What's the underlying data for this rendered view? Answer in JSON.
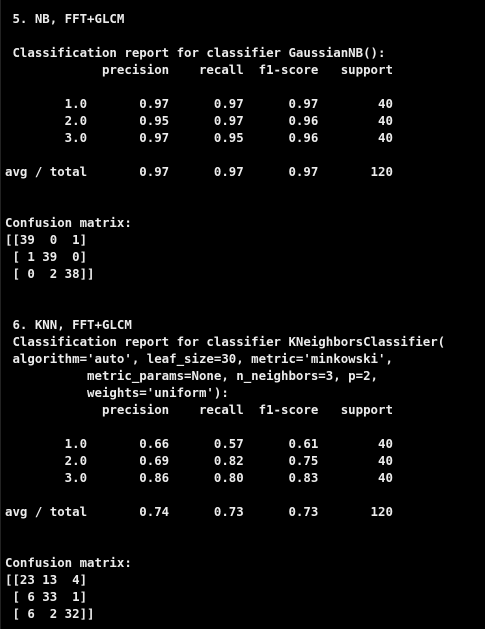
{
  "colors": {
    "background": "#000000",
    "text": "#ececec"
  },
  "terminal": {
    "lines": [
      " 5. NB, FFT+GLCM",
      "",
      " Classification report for classifier GaussianNB():",
      "             precision    recall  f1-score   support",
      "",
      "        1.0       0.97      0.97      0.97        40",
      "        2.0       0.95      0.97      0.96        40",
      "        3.0       0.97      0.95      0.96        40",
      "",
      "avg / total       0.97      0.97      0.97       120",
      "",
      "",
      "Confusion matrix:",
      "[[39  0  1]",
      " [ 1 39  0]",
      " [ 0  2 38]]",
      "",
      "",
      " 6. KNN, FFT+GLCM",
      " Classification report for classifier KNeighborsClassifier(",
      " algorithm='auto', leaf_size=30, metric='minkowski',",
      "           metric_params=None, n_neighbors=3, p=2,",
      "           weights='uniform'):",
      "             precision    recall  f1-score   support",
      "",
      "        1.0       0.66      0.57      0.61        40",
      "        2.0       0.69      0.82      0.75        40",
      "        3.0       0.86      0.80      0.83        40",
      "",
      "avg / total       0.74      0.73      0.73       120",
      "",
      "",
      "Confusion matrix:",
      "[[23 13  4]",
      " [ 6 33  1]",
      " [ 6  2 32]]"
    ]
  }
}
